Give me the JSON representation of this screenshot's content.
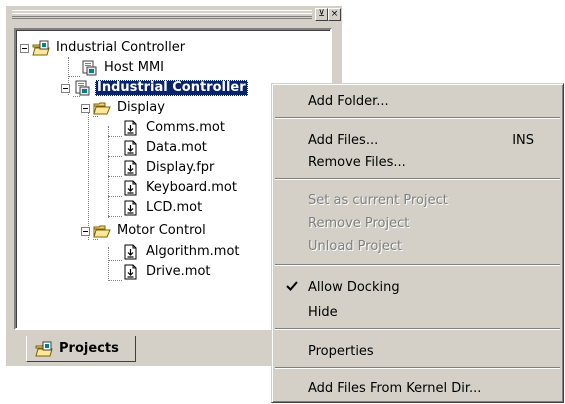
{
  "window": {
    "restore_glyph": "⊻",
    "close_glyph": "×"
  },
  "tree": {
    "root": {
      "label": "Industrial Controller",
      "icon": "project-group-icon"
    },
    "host": {
      "label": "Host MMI",
      "icon": "project-icon"
    },
    "project": {
      "label": "Industrial Controller",
      "icon": "project-icon",
      "selected": true
    },
    "folder_display": {
      "label": "Display",
      "icon": "folder-open-icon"
    },
    "display_files": [
      "Comms.mot",
      "Data.mot",
      "Display.fpr",
      "Keyboard.mot",
      "LCD.mot"
    ],
    "folder_motor": {
      "label": "Motor Control",
      "icon": "folder-open-icon"
    },
    "motor_files": [
      "Algorithm.mot",
      "Drive.mot"
    ]
  },
  "tab": {
    "label": "Projects",
    "icon": "project-group-icon"
  },
  "context_menu": {
    "add_folder": "Add Folder...",
    "add_files": "Add Files...",
    "add_files_shortcut": "INS",
    "remove_files": "Remove Files...",
    "set_current": "Set as current Project",
    "remove_project": "Remove Project",
    "unload_project": "Unload Project",
    "allow_docking": "Allow Docking",
    "allow_docking_checked": true,
    "hide": "Hide",
    "properties": "Properties",
    "add_kernel": "Add Files From Kernel Dir..."
  },
  "colors": {
    "face": "#d4d0c8",
    "selection": "#0a246a",
    "disabled_text": "#808080"
  }
}
